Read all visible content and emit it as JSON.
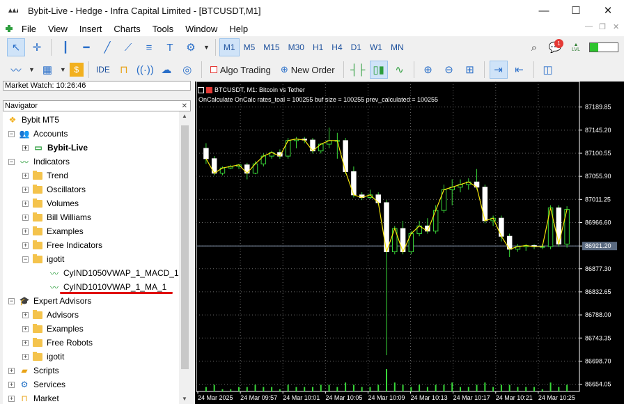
{
  "window": {
    "title": "Bybit-Live - Hedge - Infra Capital Limited - [BTCUSDT,M1]"
  },
  "menu": [
    "File",
    "View",
    "Insert",
    "Charts",
    "Tools",
    "Window",
    "Help"
  ],
  "toolbar": {
    "timeframes": [
      "M1",
      "M5",
      "M15",
      "M30",
      "H1",
      "H4",
      "D1",
      "W1",
      "MN"
    ],
    "active_timeframe": "M1",
    "notification_count": "1",
    "ide_label": "IDE",
    "algo_trading_label": "Algo Trading",
    "new_order_label": "New Order",
    "lvl_label": "LVL"
  },
  "market_watch": {
    "title": "Market Watch: 10:26:46"
  },
  "navigator": {
    "title": "Navigator",
    "root": "Bybit MT5",
    "accounts": {
      "label": "Accounts",
      "items": [
        "Bybit-Live"
      ]
    },
    "indicators": {
      "label": "Indicators",
      "items": [
        "Trend",
        "Oscillators",
        "Volumes",
        "Bill Williams",
        "Examples",
        "Free Indicators",
        "igotit"
      ],
      "igotit_children": [
        "CyIND1050VWAP_1_MACD_1",
        "CyIND1010VWAP_1_MA_1"
      ]
    },
    "experts": {
      "label": "Expert Advisors",
      "items": [
        "Advisors",
        "Examples",
        "Free Robots",
        "igotit"
      ]
    },
    "scripts": "Scripts",
    "services": "Services",
    "market": "Market"
  },
  "chart_data": {
    "type": "candlestick",
    "symbol_label": "BTCUSDT, M1:  Bitcoin vs Tether",
    "info_text": "OnCalculate OnCalc rates_toal = 100255 buf size = 100255 prev_calculated = 100255",
    "price_ticks": [
      "87189.85",
      "87145.20",
      "87100.55",
      "87055.90",
      "87011.25",
      "86966.60",
      "86921.20",
      "86877.30",
      "86832.65",
      "86788.00",
      "86743.35",
      "86698.70",
      "86654.05"
    ],
    "ylim": [
      86640,
      87215
    ],
    "current_price": "86921.20",
    "time_labels": [
      "24 Mar 2025",
      "24 Mar 09:57",
      "24 Mar 10:01",
      "24 Mar 10:05",
      "24 Mar 10:09",
      "24 Mar 10:13",
      "24 Mar 10:17",
      "24 Mar 10:21",
      "24 Mar 10:25"
    ],
    "candles": [
      [
        87110,
        87120,
        87080,
        87090
      ],
      [
        87090,
        87095,
        87058,
        87062
      ],
      [
        87062,
        87075,
        87058,
        87072
      ],
      [
        87072,
        87078,
        87070,
        87075
      ],
      [
        87075,
        87080,
        87070,
        87078
      ],
      [
        87078,
        87082,
        87050,
        87062
      ],
      [
        87062,
        87085,
        87060,
        87080
      ],
      [
        87080,
        87100,
        87075,
        87095
      ],
      [
        87095,
        87105,
        87090,
        87102
      ],
      [
        87102,
        87108,
        87090,
        87095
      ],
      [
        87095,
        87130,
        87090,
        87125
      ],
      [
        87125,
        87132,
        87110,
        87128
      ],
      [
        87128,
        87132,
        87120,
        87126
      ],
      [
        87126,
        87130,
        87100,
        87105
      ],
      [
        87105,
        87120,
        87100,
        87118
      ],
      [
        87118,
        87150,
        87110,
        87125
      ],
      [
        87125,
        87140,
        87090,
        87125
      ],
      [
        87125,
        87130,
        87060,
        87065
      ],
      [
        87065,
        87075,
        87015,
        87020
      ],
      [
        87020,
        87025,
        87010,
        87015
      ],
      [
        87015,
        87030,
        87012,
        87020
      ],
      [
        87020,
        87025,
        87000,
        87005
      ],
      [
        87005,
        87010,
        86710,
        86910
      ],
      [
        86910,
        86960,
        86905,
        86955
      ],
      [
        86955,
        86970,
        86905,
        86910
      ],
      [
        86910,
        86950,
        86905,
        86945
      ],
      [
        86945,
        86970,
        86940,
        86960
      ],
      [
        86960,
        86975,
        86945,
        86950
      ],
      [
        86950,
        87000,
        86945,
        86990
      ],
      [
        86990,
        87040,
        86985,
        87030
      ],
      [
        87030,
        87050,
        87000,
        87035
      ],
      [
        87035,
        87050,
        87025,
        87040
      ],
      [
        87040,
        87052,
        87030,
        87045
      ],
      [
        87045,
        87070,
        87030,
        87035
      ],
      [
        87035,
        87040,
        86965,
        86970
      ],
      [
        86970,
        86980,
        86960,
        86975
      ],
      [
        86975,
        86980,
        86930,
        86940
      ],
      [
        86940,
        86945,
        86900,
        86915
      ],
      [
        86915,
        86925,
        86910,
        86920
      ],
      [
        86920,
        86925,
        86912,
        86922
      ],
      [
        86922,
        86925,
        86915,
        86920
      ],
      [
        86920,
        86925,
        86915,
        86920
      ],
      [
        86920,
        87000,
        86915,
        86995
      ],
      [
        86995,
        87000,
        86920,
        86925
      ],
      [
        86925,
        86998,
        86918,
        86992
      ]
    ],
    "volumes": [
      2,
      3,
      1,
      1,
      2,
      2,
      3,
      2,
      2,
      1,
      3,
      2,
      2,
      2,
      3,
      3,
      2,
      4,
      3,
      2,
      2,
      3,
      10,
      4,
      3,
      2,
      3,
      2,
      3,
      3,
      4,
      2,
      2,
      3,
      4,
      2,
      3,
      3,
      2,
      2,
      2,
      1,
      4,
      2,
      3
    ]
  }
}
